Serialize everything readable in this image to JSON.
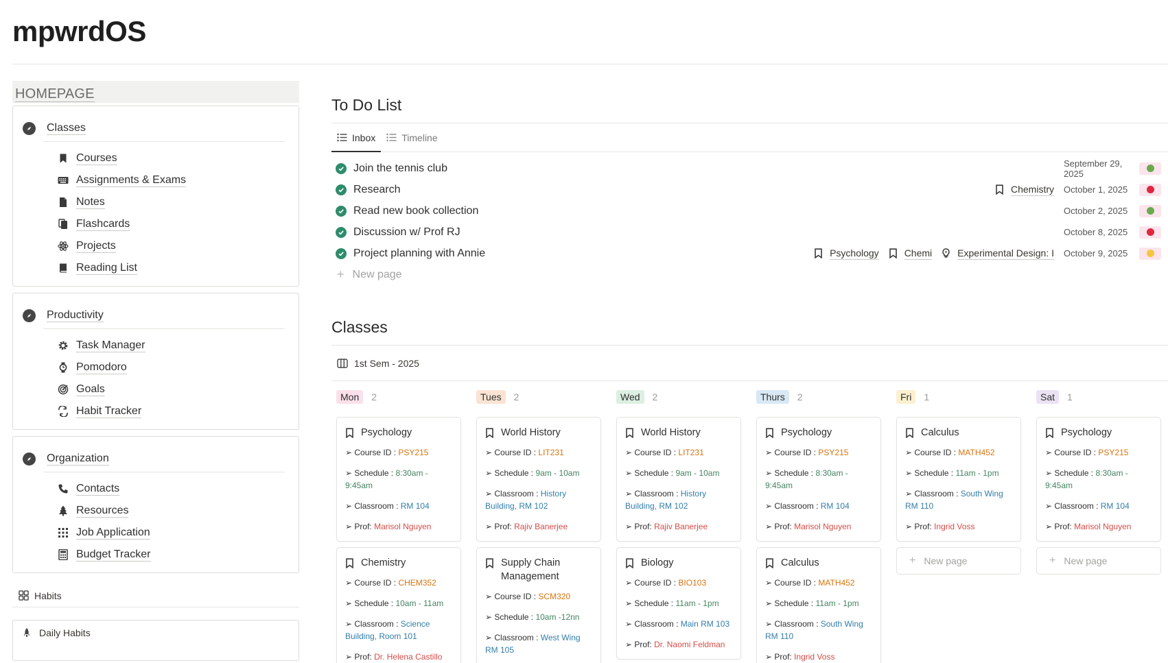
{
  "app": {
    "title": "mpwrdOS"
  },
  "sidebar": {
    "homepage_label": "HOMEPAGE",
    "groups": [
      {
        "title": "Classes",
        "items": [
          {
            "label": "Courses",
            "icon": "bookmark-icon"
          },
          {
            "label": "Assignments & Exams",
            "icon": "keyboard-icon"
          },
          {
            "label": "Notes",
            "icon": "document-icon"
          },
          {
            "label": "Flashcards",
            "icon": "cards-icon"
          },
          {
            "label": "Projects",
            "icon": "atom-icon"
          },
          {
            "label": "Reading List",
            "icon": "book-icon"
          }
        ]
      },
      {
        "title": "Productivity",
        "items": [
          {
            "label": "Task Manager",
            "icon": "gear-icon"
          },
          {
            "label": "Pomodoro",
            "icon": "watch-icon"
          },
          {
            "label": "Goals",
            "icon": "target-icon"
          },
          {
            "label": "Habit Tracker",
            "icon": "repeat-icon"
          }
        ]
      },
      {
        "title": "Organization",
        "items": [
          {
            "label": "Contacts",
            "icon": "phone-icon"
          },
          {
            "label": "Resources",
            "icon": "tree-icon"
          },
          {
            "label": "Job Application",
            "icon": "grid-icon"
          },
          {
            "label": "Budget Tracker",
            "icon": "calculator-icon"
          }
        ]
      }
    ],
    "habits_label": "Habits",
    "daily_habits_label": "Daily Habits"
  },
  "todo": {
    "title": "To Do List",
    "tabs": [
      {
        "label": "Inbox"
      },
      {
        "label": "Timeline"
      }
    ],
    "items": [
      {
        "name": "Join the tennis club",
        "relations": [],
        "date": "September 29, 2025",
        "priority_color": "#6aaa4e",
        "priority_bg": "#fbe4ec"
      },
      {
        "name": "Research",
        "relations": [
          {
            "label": "Chemistry",
            "icon": "bookmark-icon"
          }
        ],
        "date": "October 1, 2025",
        "priority_color": "#e0263f",
        "priority_bg": "#fbe4ec"
      },
      {
        "name": "Read new book collection",
        "relations": [],
        "date": "October 2, 2025",
        "priority_color": "#6aaa4e",
        "priority_bg": "#fbe4ec"
      },
      {
        "name": "Discussion w/ Prof RJ",
        "relations": [],
        "date": "October 8, 2025",
        "priority_color": "#e0263f",
        "priority_bg": "#fbe4ec"
      },
      {
        "name": "Project planning with Annie",
        "relations": [
          {
            "label": "Psychology",
            "icon": "bookmark-icon"
          },
          {
            "label": "Chemi",
            "icon": "bookmark-icon"
          },
          {
            "label": "Experimental Design: I",
            "icon": "lightbulb-icon"
          }
        ],
        "date": "October 9, 2025",
        "priority_color": "#f5c542",
        "priority_bg": "#fbe4ec"
      }
    ],
    "new_page_label": "New page"
  },
  "classes": {
    "title": "Classes",
    "view_label": "1st Sem - 2025",
    "columns": [
      {
        "day": "Mon",
        "count": "2",
        "tag_bg": "#fbe0ea",
        "cards": [
          {
            "title": "Psychology",
            "course_id": "PSY215",
            "schedule": "8:30am - 9:45am",
            "classroom": "RM 104",
            "prof": "Marisol Nguyen"
          },
          {
            "title": "Chemistry",
            "course_id": "CHEM352",
            "schedule": "10am - 11am",
            "classroom": "Science Building, Room 101",
            "prof": "Dr. Helena Castillo"
          }
        ]
      },
      {
        "day": "Tues",
        "count": "2",
        "tag_bg": "#fbe3d3",
        "cards": [
          {
            "title": "World History",
            "course_id": "LIT231",
            "schedule": "9am - 10am",
            "classroom": "History Building, RM 102",
            "prof": "Rajiv Banerjee"
          },
          {
            "title": "Supply Chain Management",
            "course_id": "SCM320",
            "schedule": "10am -12nn",
            "classroom": "West Wing RM 105",
            "prof": ""
          }
        ]
      },
      {
        "day": "Wed",
        "count": "2",
        "tag_bg": "#dcefe2",
        "cards": [
          {
            "title": "World History",
            "course_id": "LIT231",
            "schedule": "9am - 10am",
            "classroom": "History Building, RM 102",
            "prof": "Rajiv Banerjee"
          },
          {
            "title": "Biology",
            "course_id": "BIO103",
            "schedule": "11am - 1pm",
            "classroom": "Main RM 103",
            "prof": "Dr. Naomi Feldman"
          }
        ]
      },
      {
        "day": "Thurs",
        "count": "2",
        "tag_bg": "#d8e9f5",
        "cards": [
          {
            "title": "Psychology",
            "course_id": "PSY215",
            "schedule": "8:30am - 9:45am",
            "classroom": "RM 104",
            "prof": "Marisol Nguyen"
          },
          {
            "title": "Calculus",
            "course_id": "MATH452",
            "schedule": "11am - 1pm",
            "classroom": "South Wing RM 110",
            "prof": "Ingrid Voss"
          }
        ]
      },
      {
        "day": "Fri",
        "count": "1",
        "tag_bg": "#fbf0cf",
        "cards": [
          {
            "title": "Calculus",
            "course_id": "MATH452",
            "schedule": "11am - 1pm",
            "classroom": "South Wing RM 110",
            "prof": "Ingrid Voss"
          }
        ]
      },
      {
        "day": "Sat",
        "count": "1",
        "tag_bg": "#ebe2f3",
        "cards": [
          {
            "title": "Psychology",
            "course_id": "PSY215",
            "schedule": "8:30am - 9:45am",
            "classroom": "RM 104",
            "prof": "Marisol Nguyen"
          }
        ]
      }
    ],
    "labels": {
      "course_id": "➢ Course ID : ",
      "schedule": "➢ Schedule : ",
      "classroom": "➢ Classroom : ",
      "prof": "➢ Prof: "
    },
    "new_page_label": "New page"
  }
}
